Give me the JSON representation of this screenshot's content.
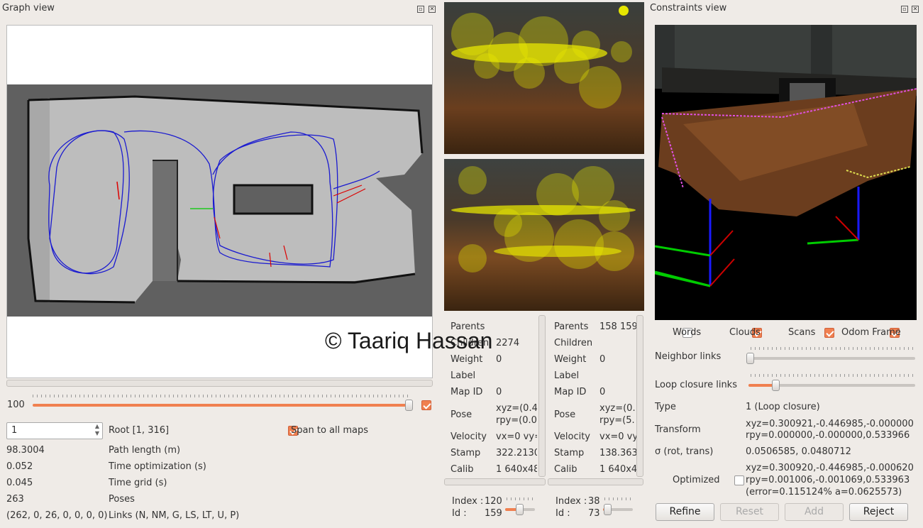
{
  "graph_view": {
    "title": "Graph view",
    "slider_value": "100",
    "spin_value": "1",
    "root_label": "Root [1, 316]",
    "span_label": "Span to all maps",
    "stats": [
      {
        "value": "98.3004",
        "label": "Path length (m)"
      },
      {
        "value": "0.052",
        "label": "Time optimization (s)"
      },
      {
        "value": "0.045",
        "label": "Time grid (s)"
      },
      {
        "value": "263",
        "label": "Poses"
      },
      {
        "value": "(262, 0, 26, 0, 0, 0, 0)",
        "label": "Links (N, NM, G, LS, LT, U, P)"
      }
    ]
  },
  "node_left": {
    "rows": [
      {
        "k": "Parents",
        "v": ""
      },
      {
        "k": "Children",
        "v": "2274"
      },
      {
        "k": "Weight",
        "v": "0"
      },
      {
        "k": "Label",
        "v": ""
      },
      {
        "k": "Map ID",
        "v": "0"
      },
      {
        "k": "Pose",
        "v": "xyz=(0.4",
        "v2": "rpy=(0.0"
      },
      {
        "k": "Velocity",
        "v": "vx=0 vy="
      },
      {
        "k": "Stamp",
        "v": "322.2130"
      },
      {
        "k": "Calib",
        "v": "1 640x48"
      }
    ],
    "index_label": "Index :",
    "index_value": "120",
    "id_label": "Id :",
    "id_value": "159"
  },
  "node_right": {
    "rows": [
      {
        "k": "Parents",
        "v": "158 159"
      },
      {
        "k": "Children",
        "v": ""
      },
      {
        "k": "Weight",
        "v": "0"
      },
      {
        "k": "Label",
        "v": ""
      },
      {
        "k": "Map ID",
        "v": "0"
      },
      {
        "k": "Pose",
        "v": "xyz=(0.",
        "v2": "rpy=(5."
      },
      {
        "k": "Velocity",
        "v": "vx=0 vy"
      },
      {
        "k": "Stamp",
        "v": "138.363"
      },
      {
        "k": "Calib",
        "v": "1 640x4"
      }
    ],
    "index_label": "Index :",
    "index_value": "38",
    "id_label": "Id :",
    "id_value": "73"
  },
  "constraints_view": {
    "title": "Constraints view",
    "checks": [
      {
        "label": "Words",
        "on": false
      },
      {
        "label": "Clouds",
        "on": true
      },
      {
        "label": "Scans",
        "on": true
      },
      {
        "label": "Odom Frame",
        "on": true
      }
    ],
    "neighbor_label": "Neighbor links",
    "loop_label": "Loop closure links",
    "type_label": "Type",
    "type_value": "1 (Loop closure)",
    "transform_label": "Transform",
    "transform_l1": "xyz=0.300921,-0.446985,-0.000000",
    "transform_l2": "rpy=0.000000,-0.000000,0.533966",
    "sigma_label": "σ (rot, trans)",
    "sigma_value": "0.0506585, 0.0480712",
    "optimized_label": "Optimized",
    "opt_l1": "xyz=0.300920,-0.446985,-0.000620",
    "opt_l2": "rpy=0.001006,-0.001069,0.533963",
    "opt_l3": "(error=0.115124% a=0.0625573)",
    "buttons": {
      "refine": "Refine",
      "reset": "Reset",
      "add": "Add",
      "reject": "Reject"
    }
  },
  "watermark": "© Taariq Hassan"
}
